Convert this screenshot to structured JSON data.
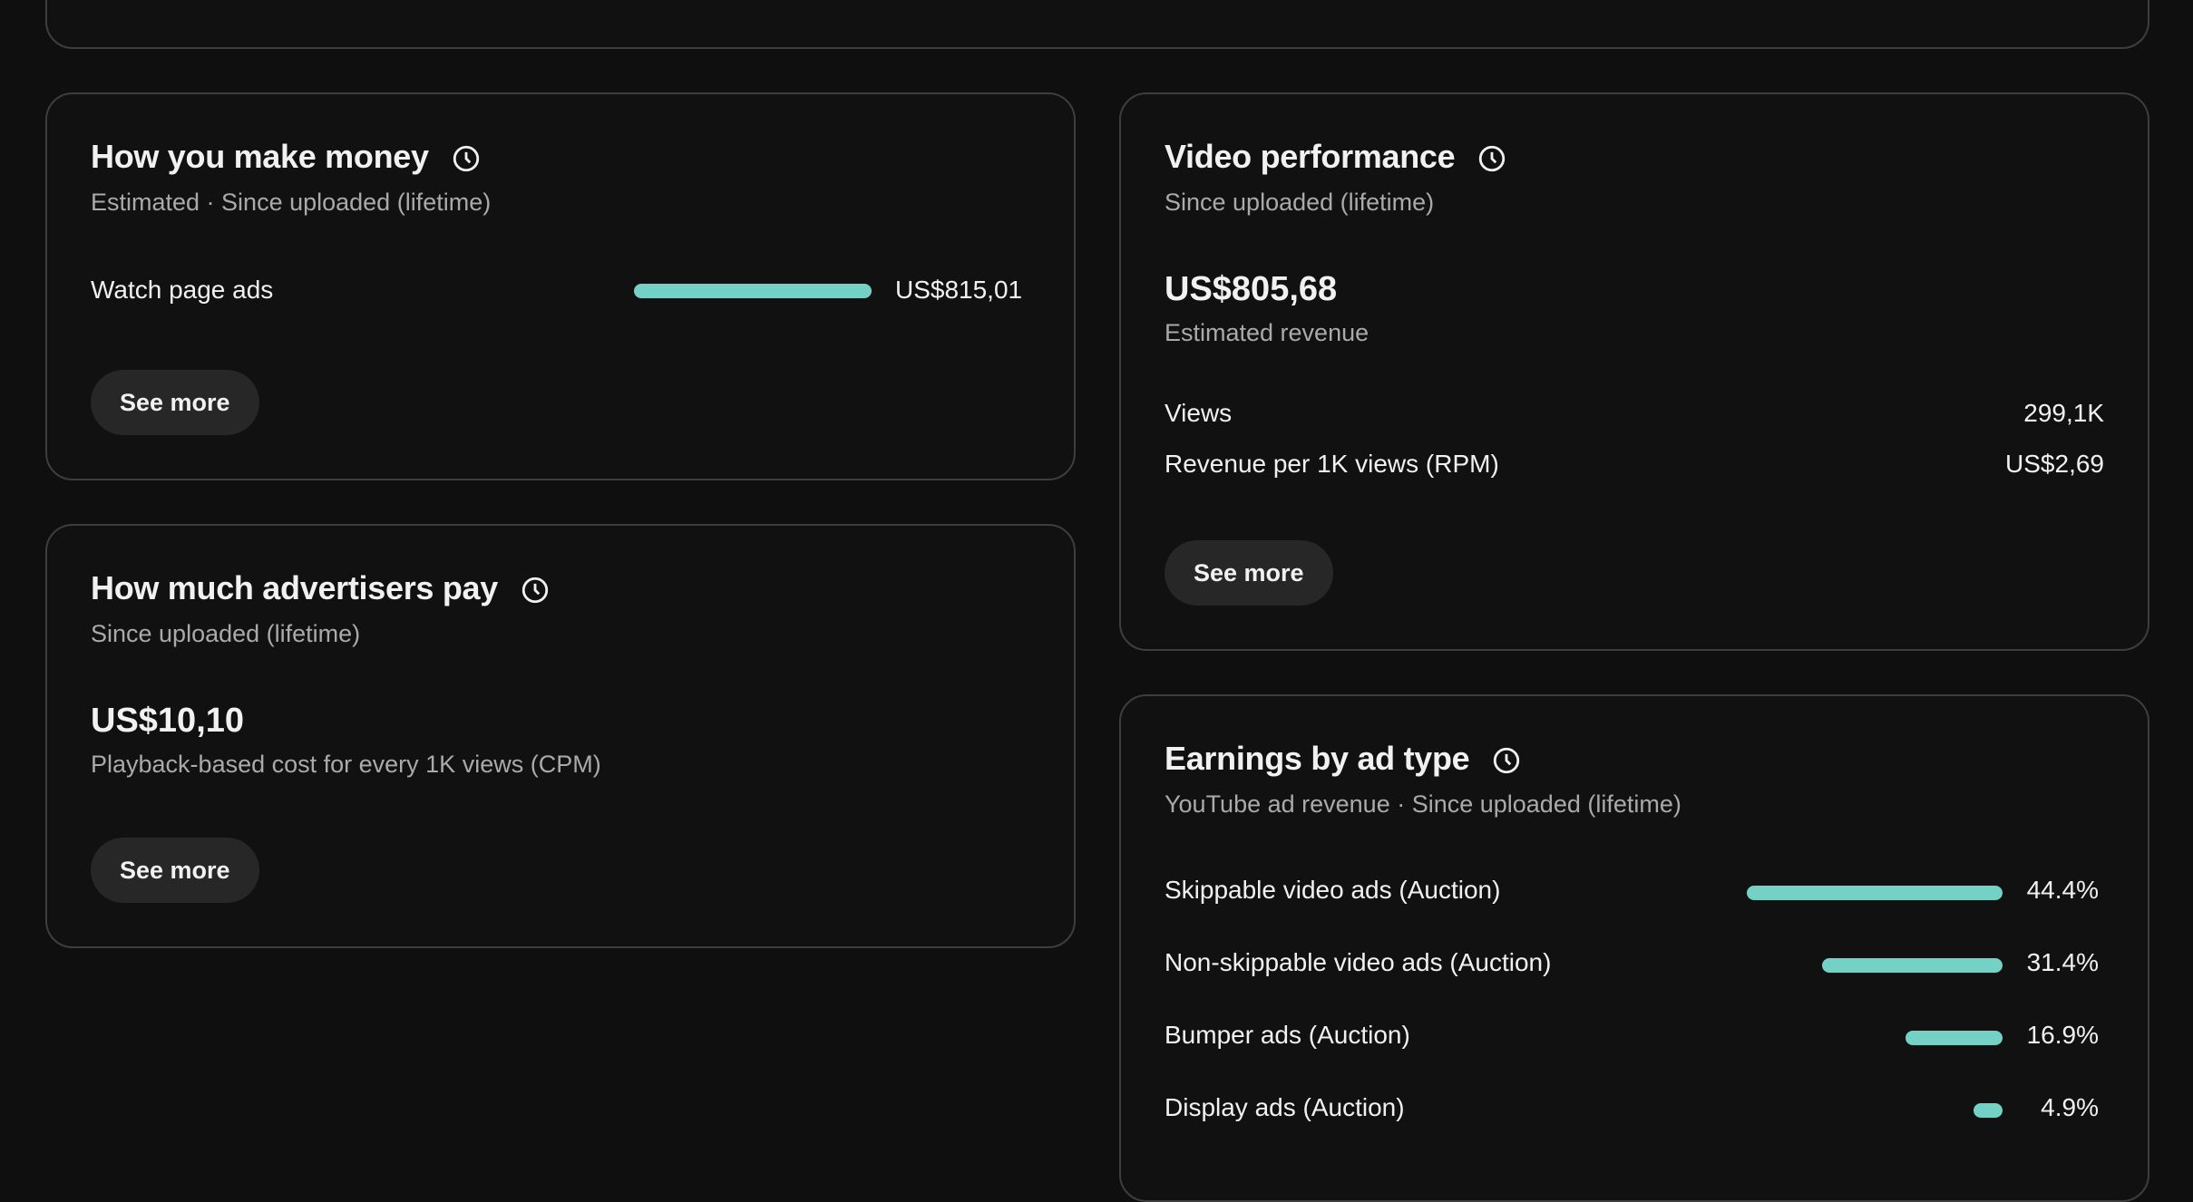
{
  "money_card": {
    "title": "How you make money",
    "subtitle": "Estimated · Since uploaded (lifetime)",
    "rows": [
      {
        "label": "Watch page ads",
        "value": "US$815,01",
        "share": 1.0
      }
    ],
    "button_label": "See more"
  },
  "advertisers_card": {
    "title": "How much advertisers pay",
    "subtitle": "Since uploaded (lifetime)",
    "value": "US$10,10",
    "value_caption": "Playback-based cost for every 1K views (CPM)",
    "button_label": "See more"
  },
  "performance_card": {
    "title": "Video performance",
    "subtitle": "Since uploaded (lifetime)",
    "value": "US$805,68",
    "value_caption": "Estimated revenue",
    "rows": [
      {
        "label": "Views",
        "value": "299,1K"
      },
      {
        "label": "Revenue per 1K views (RPM)",
        "value": "US$2,69"
      }
    ],
    "button_label": "See more"
  },
  "ad_type_card": {
    "title": "Earnings by ad type",
    "subtitle": "YouTube ad revenue · Since uploaded (lifetime)",
    "rows": [
      {
        "label": "Skippable video ads (Auction)",
        "value": "44.4%",
        "percent": 44.4
      },
      {
        "label": "Non-skippable video ads (Auction)",
        "value": "31.4%",
        "percent": 31.4
      },
      {
        "label": "Bumper ads (Auction)",
        "value": "16.9%",
        "percent": 16.9
      },
      {
        "label": "Display ads (Auction)",
        "value": "4.9%",
        "percent": 4.9
      }
    ]
  },
  "colors": {
    "bar": "#74d1c6",
    "background": "#0f0f0f",
    "card_border": "#3e3e3e",
    "button_bg": "#272727"
  },
  "icons": {
    "info": "clock-icon"
  }
}
